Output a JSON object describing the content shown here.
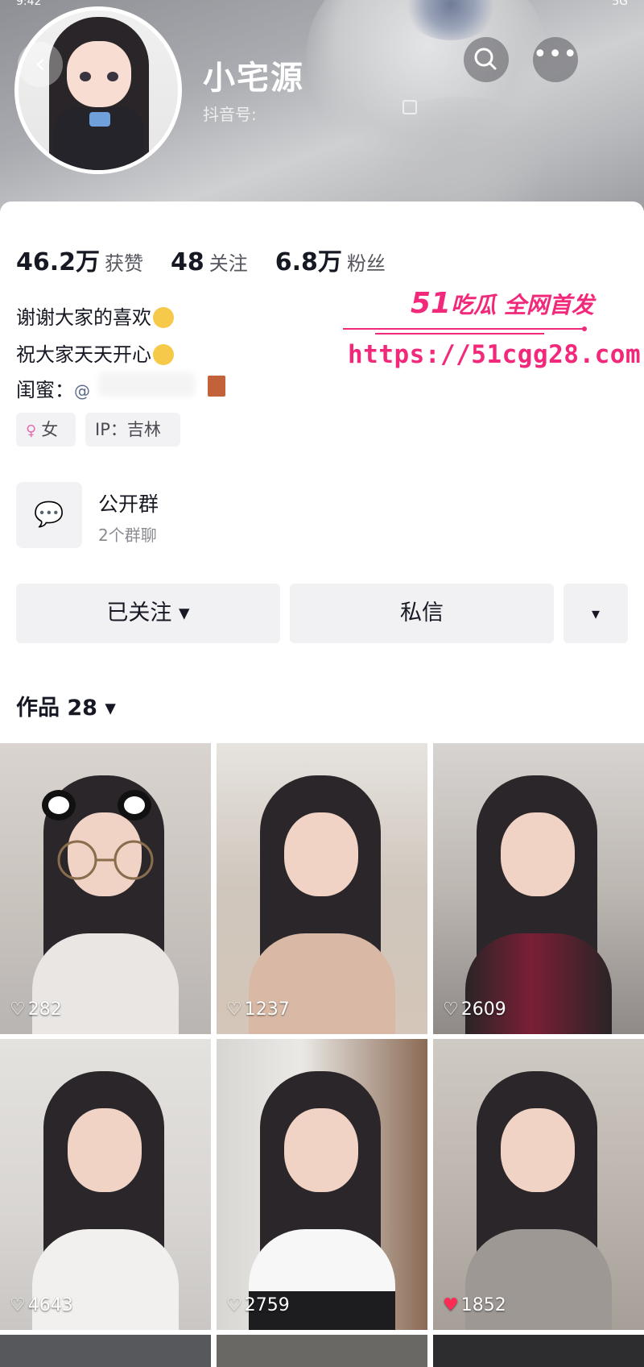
{
  "status_bar": {
    "left": "9:42",
    "right": "5G"
  },
  "header": {
    "nickname": "小宅源",
    "douyin_id_label": "抖音号:",
    "back_icon": "chevron-left-icon",
    "search_icon": "search-icon",
    "more_icon": "more-horizontal-icon"
  },
  "stats": [
    {
      "value": "46.2万",
      "label": "获赞"
    },
    {
      "value": "48",
      "label": "关注"
    },
    {
      "value": "6.8万",
      "label": "粉丝"
    }
  ],
  "bio": {
    "line1": "谢谢大家的喜欢",
    "line2": "祝大家天天开心",
    "bestie_label": "闺蜜：",
    "bestie_prefix": "@"
  },
  "tags": {
    "gender": "女",
    "ip": "IP：吉林"
  },
  "group": {
    "title": "公开群",
    "subtitle": "2个群聊"
  },
  "actions": {
    "follow": "已关注 ▾",
    "message": "私信",
    "more": "▾"
  },
  "works": {
    "label": "作品 28 ▾"
  },
  "watermark": {
    "logo": "51",
    "logo_text": "吃瓜 全网首发",
    "url": "https://51cgg28.com"
  },
  "videos": [
    {
      "likes": "282"
    },
    {
      "likes": "1237"
    },
    {
      "likes": "2609"
    },
    {
      "likes": "4643"
    },
    {
      "likes": "2759"
    },
    {
      "likes": "1852"
    }
  ],
  "colors": {
    "accent": "#f2297a",
    "liked_heart": "#fe2c55",
    "button_bg": "#f1f1f3"
  }
}
